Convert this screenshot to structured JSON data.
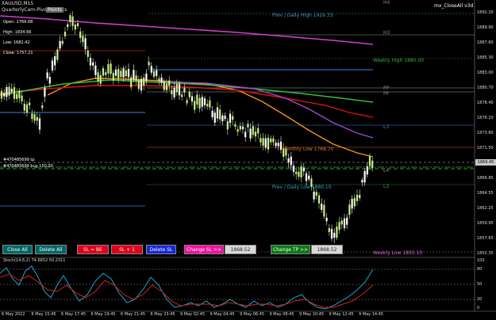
{
  "chart_header": {
    "symbol": "XAUUSD,M15",
    "indicator_name": "QuarterlyCam-Pivots-Points",
    "tab_button": "Points",
    "ea_name": "mx_CloseAll v3d"
  },
  "info_panel": {
    "open": "Open: 1769.68",
    "high": "High: 1834.66",
    "low": "Low: 1682.42",
    "close": "Close: 1757.21",
    "trade_line_1": "#470485699 tp",
    "trade_line_2": "#470485699 buy 150.00"
  },
  "levels": {
    "prev_daily_high": "Prev / Daily High 1929.33",
    "h3": "H3",
    "h4_top": "H4",
    "weekly_high": "Weekly High 1880.00",
    "pp_upper": "PP",
    "pp_lower": "PP",
    "l3_upper": "L3",
    "monthly_low": "Monthly Low 1768.70",
    "l4": "L4",
    "l3_lower": "L3",
    "prev_daily_low": "Prev / Daily Low 1880.10",
    "weekly_low": "Weekly Low 1850.10"
  },
  "price_axis": [
    "1892.20",
    "1889.90",
    "1887.60",
    "1885.30",
    "1883.00",
    "1880.70",
    "1878.40",
    "1876.10",
    "1873.80",
    "1871.50",
    "1869.45",
    "1866.85",
    "1864.55",
    "1862.25",
    "1859.95",
    "1857.65",
    "1855.35"
  ],
  "current_price": "1869.45",
  "current_price_color": "#c8c8c8",
  "stoch": {
    "label": "Stoch(14,6,2) 74.6652 50.2311",
    "axis": [
      "100",
      "80",
      "50",
      "20",
      "0"
    ]
  },
  "time_axis": [
    "6 May 2022",
    "6 May 15:45",
    "6 May 17:45",
    "6 May 19:45",
    "6 May 21:45",
    "6 May 23:45",
    "9 May 02:45",
    "9 May 04:45",
    "9 May 06:45",
    "9 May 08:45",
    "9 May 10:45",
    "9 May 12:45",
    "9 May 14:45"
  ],
  "buttons": {
    "close_all": "Close All",
    "delete_all": "Delete All",
    "sl_be": "SL = BE",
    "sl_plus_1": "SL + 1",
    "delete_sl": "Delete SL",
    "change_sl": "Change SL >>",
    "sl_value": "1868.52",
    "change_tp": "Change TP >>",
    "tp_value": "1868.52"
  },
  "colors": {
    "bull_candle": "#ffffff",
    "bear_candle": "#c8f088",
    "ma_magenta": "#d33dd3",
    "ma_orange": "#f5941d",
    "ma_red": "#e01010",
    "ma_green": "#34c234",
    "ma_purple": "#9a4ad0",
    "stoch_main": "#1aa6c7",
    "stoch_signal": "#d02222"
  }
}
